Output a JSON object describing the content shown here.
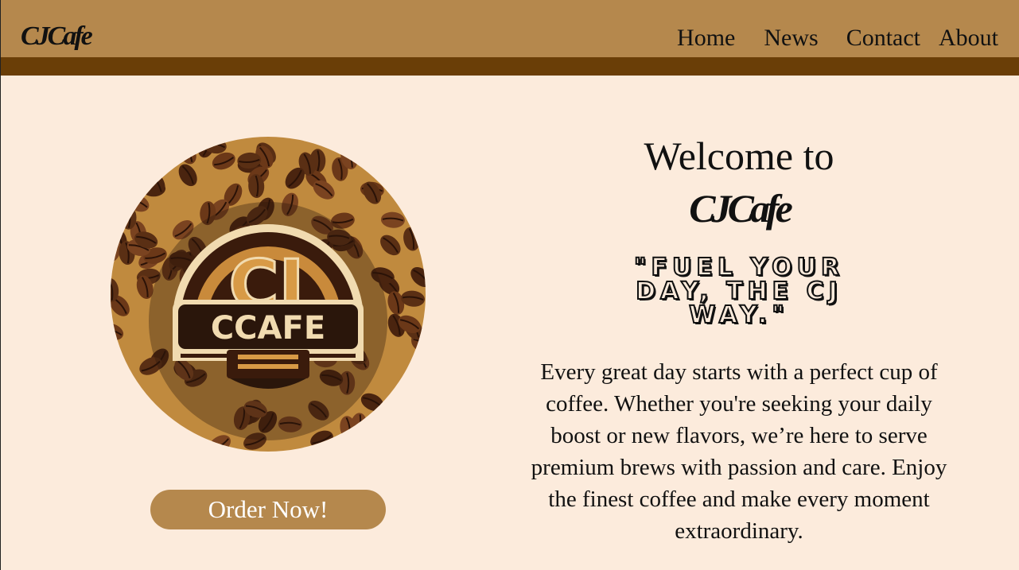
{
  "header": {
    "brand": "CJCafe",
    "nav": [
      "Home",
      "News",
      "Contact",
      "About"
    ]
  },
  "hero": {
    "logo": {
      "ring_text": "CJ",
      "badge_text": "CCAFE"
    },
    "order_button": "Order Now!",
    "welcome": "Welcome to",
    "brand": "CJCafe",
    "tagline": "\"Fuel your day, the CJ way.\"",
    "description": "Every great day starts with a perfect cup of coffee. Whether you're seeking your daily boost or new flavors, we’re here to serve premium brews with passion and care. Enjoy the finest coffee and make every moment extraordinary."
  },
  "colors": {
    "page_bg": "#fcebdc",
    "header_bg": "#b5884d",
    "header_stripe": "#6a3e07",
    "button_bg": "#b5884d",
    "button_text": "#ffffff",
    "text": "#111111"
  }
}
